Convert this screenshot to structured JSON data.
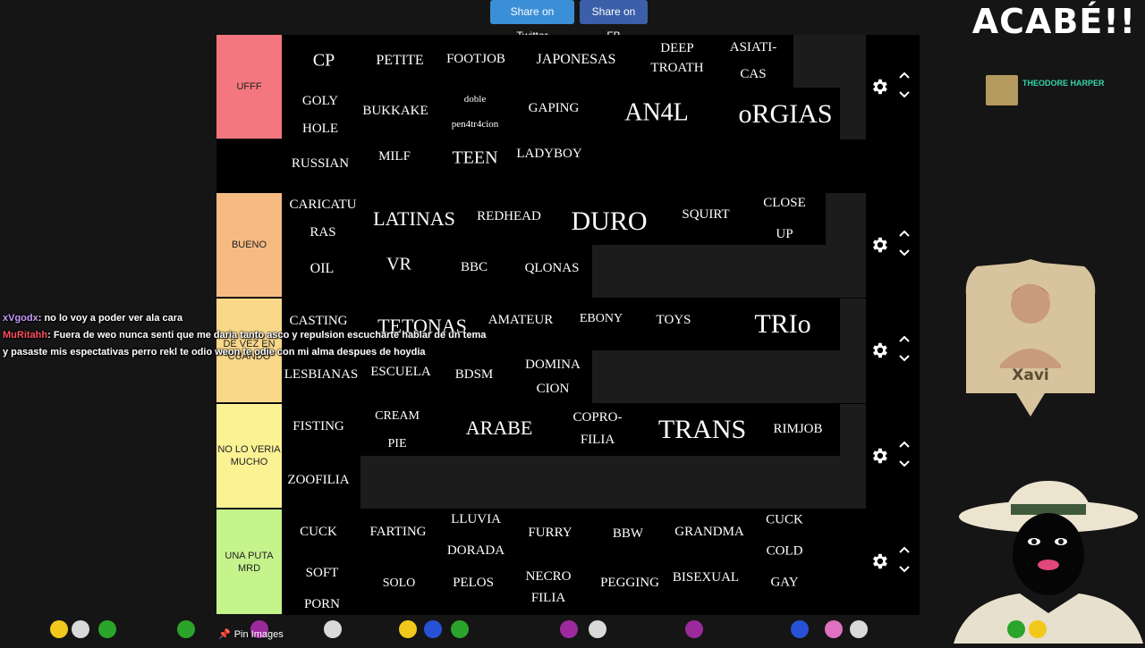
{
  "share": {
    "twitter": "Share on Twitter",
    "facebook": "Share on FB"
  },
  "overlay": {
    "title": "ACABÉ!!",
    "follower_name": "THEODORE HARPER",
    "player_card_name": "Xavi"
  },
  "tiers": [
    {
      "label": "UFFF",
      "color": "#f4767e",
      "items": [
        "CP",
        "PETITE",
        "FOOTJOB",
        "JAPONESAS",
        "DEEP\nTROATH",
        "ASIATI-\nCAS",
        "GOLY\nHOLE",
        "BUKKAKE",
        "doble\npen4tr4cion",
        "GAPING",
        "AN4L",
        "oRGIAS",
        "RUSSIAN",
        "MILF",
        "TEEN",
        "LADYBOY"
      ]
    },
    {
      "label": "BUENO",
      "color": "#f7bb82",
      "items": [
        "CARICATU\nRAS",
        "LATINAS",
        "REDHEAD",
        "DURO",
        "SQUIRT",
        "CLOSE\nUP",
        "OIL",
        "VR",
        "BBC",
        "QLONAS"
      ]
    },
    {
      "label": "DE VEZ EN CUANDO",
      "color": "#fad88a",
      "items": [
        "CASTING",
        "TETONAS",
        "AMATEUR",
        "EBONY",
        "TOYS",
        "TRIo",
        "LESBIANAS",
        "ESCUELA",
        "BDSM",
        "DOMINA\nCION"
      ]
    },
    {
      "label": "NO LO VERIA MUCHO",
      "color": "#fbf294",
      "items": [
        "FISTING",
        "CREAM\nPIE",
        "ARABE",
        "COPRO-\nFILIA",
        "TRANS",
        "RIMJOB",
        "ZOOFILIA"
      ]
    },
    {
      "label": "UNA PUTA MRD",
      "color": "#c5f38c",
      "items": [
        "CUCK",
        "FARTING",
        "LLUVIA\nDORADA",
        "FURRY",
        "BBW",
        "GRANDMA",
        "CUCK\nCOLD\nGAY",
        "SOFT\nPORN",
        "SOLO",
        "PELOS",
        "NECRO\nFILIA",
        "PEGGING",
        "BISEXUAL"
      ]
    }
  ],
  "chat": [
    {
      "user": "xVgodx",
      "user_color": "#c79bff",
      "message": ": no lo voy a poder ver ala cara"
    },
    {
      "user": "MuRitahh",
      "user_color": "#ff4f5e",
      "message": ": Fuera de weo nunca senti que me daria tanto asco y repulsion escucharte hablar de un tema"
    },
    {
      "user": "",
      "user_color": "#ffffff",
      "message": "y pasaste mis espectativas perro rekl te odio weon te odie con mi alma despues de hoydia"
    }
  ],
  "bottom": {
    "pin_images": "Pin Images"
  }
}
